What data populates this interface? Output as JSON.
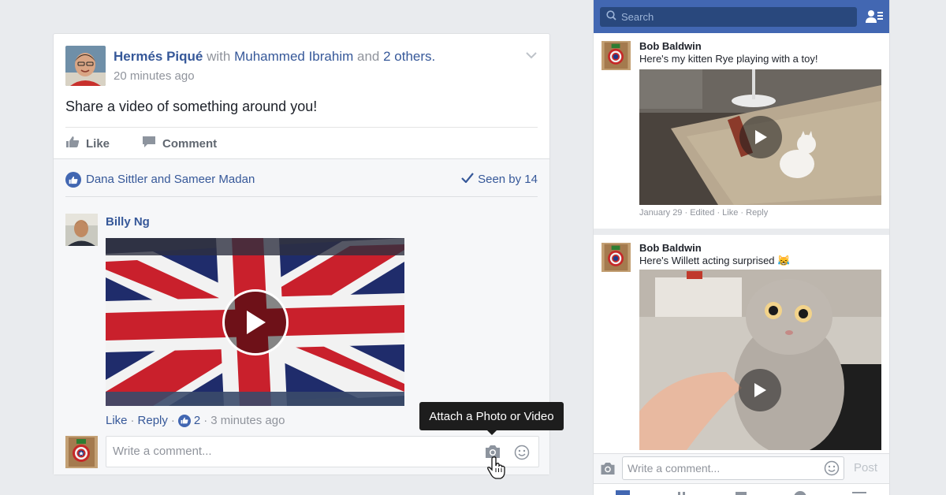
{
  "post": {
    "author": "Hermés Piqué",
    "with_word": "with",
    "tagged": "Muhammed Ibrahim",
    "and_word": "and",
    "others": "2 others.",
    "time": "20 minutes ago",
    "text": "Share a video of something around you!",
    "like_label": "Like",
    "comment_label": "Comment",
    "likes_names": "Dana Sittler and Sameer Madan",
    "seen_by": "Seen by 14"
  },
  "comment": {
    "author": "Billy Ng",
    "like_label": "Like",
    "separator": "·",
    "reply_label": "Reply",
    "like_count": "2",
    "time": "3 minutes ago"
  },
  "composer": {
    "placeholder": "Write a comment...",
    "tooltip": "Attach a Photo or Video"
  },
  "mobile": {
    "search_placeholder": "Search",
    "posts": [
      {
        "author": "Bob Baldwin",
        "text": "Here's my kitten Rye playing with a toy!",
        "meta": "January 29 · Edited · Like · Reply"
      },
      {
        "author": "Bob Baldwin",
        "text": "Here's Willett acting surprised 😹"
      }
    ],
    "comment_placeholder": "Write a comment...",
    "post_label": "Post"
  },
  "colors": {
    "brand_blue": "#4267b2",
    "link_blue": "#365899",
    "muted_gray": "#90949c",
    "page_bg": "#e9ebee"
  },
  "icons": [
    "chevron-down-icon",
    "like-icon",
    "comment-icon",
    "checkmark-icon",
    "play-icon",
    "camera-icon",
    "smile-icon",
    "hand-cursor-icon",
    "search-icon",
    "friends-icon"
  ]
}
